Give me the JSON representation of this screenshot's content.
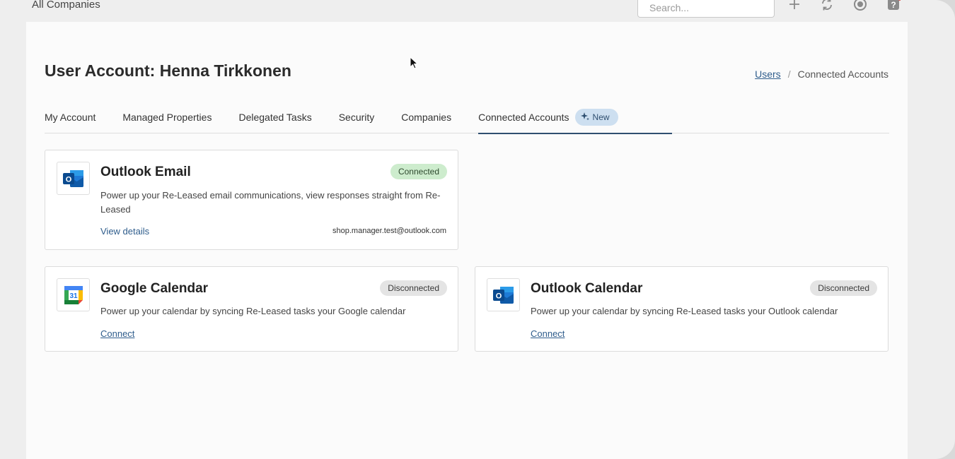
{
  "topbar": {
    "company": "All Companies",
    "search_placeholder": "Search...",
    "icons": [
      "plus-icon",
      "sync-icon",
      "support-icon",
      "help-icon"
    ]
  },
  "header": {
    "title": "User Account: Henna Tirkkonen",
    "breadcrumb": {
      "link": "Users",
      "separator": "/",
      "current": "Connected Accounts"
    }
  },
  "tabs": [
    {
      "label": "My Account"
    },
    {
      "label": "Managed Properties"
    },
    {
      "label": "Delegated Tasks"
    },
    {
      "label": "Security"
    },
    {
      "label": "Companies"
    },
    {
      "label": "Connected Accounts",
      "badge": "New",
      "active": true
    }
  ],
  "cards": {
    "outlook_email": {
      "title": "Outlook Email",
      "status": "Connected",
      "description": "Power up your Re-Leased email communications, view responses straight from Re-Leased",
      "action": "View details",
      "account": "shop.manager.test@outlook.com"
    },
    "google_calendar": {
      "title": "Google Calendar",
      "status": "Disconnected",
      "description": "Power up your calendar by syncing Re-Leased tasks your Google calendar",
      "action": "Connect",
      "logo_text": "31"
    },
    "outlook_calendar": {
      "title": "Outlook Calendar",
      "status": "Disconnected",
      "description": "Power up your calendar by syncing Re-Leased tasks your Outlook calendar",
      "action": "Connect"
    }
  },
  "colors": {
    "accent": "#2f4f70",
    "link": "#2f5d8c",
    "connected_bg": "#cdeccd",
    "disconnected_bg": "#e4e4e4",
    "badge_bg": "#cddff0"
  }
}
